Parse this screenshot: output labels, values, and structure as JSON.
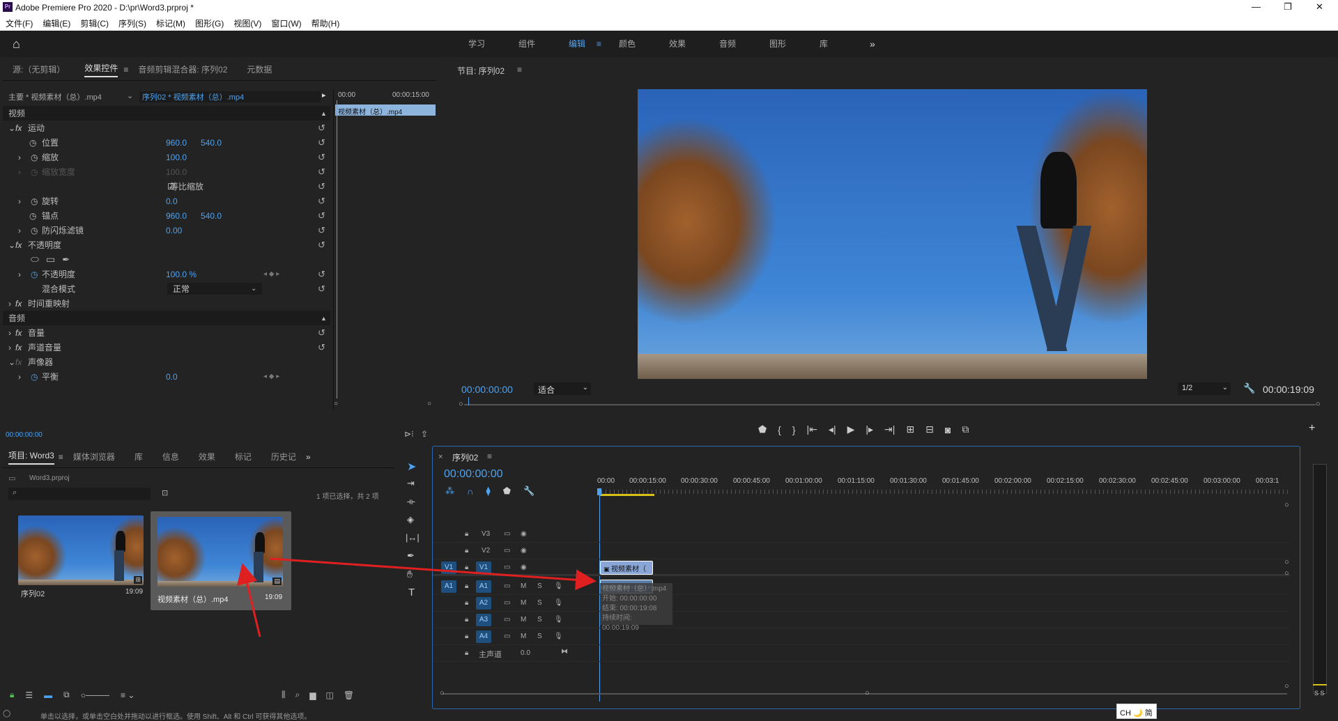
{
  "app": {
    "title": "Adobe Premiere Pro 2020 - D:\\pr\\Word3.prproj *",
    "window_controls": [
      "—",
      "❐",
      "✕"
    ]
  },
  "menu": [
    "文件(F)",
    "编辑(E)",
    "剪辑(C)",
    "序列(S)",
    "标记(M)",
    "图形(G)",
    "视图(V)",
    "窗口(W)",
    "帮助(H)"
  ],
  "workspaces": {
    "items": [
      "学习",
      "组件",
      "编辑",
      "颜色",
      "效果",
      "音频",
      "图形",
      "库"
    ],
    "active": "编辑",
    "more": "»"
  },
  "source_panel": {
    "tabs": [
      "源:（无剪辑）",
      "效果控件",
      "音频剪辑混合器: 序列02",
      "元数据"
    ],
    "active_tab": "效果控件",
    "master_label": "主要 * 视频素材（总）.mp4",
    "seq_label": "序列02 * 视频素材（总）.mp4",
    "mini_timeline": {
      "start": "00:00",
      "end": "00:00:15:00",
      "clip": "视频素材（总）.mp4"
    },
    "sections": {
      "video": "视频",
      "audio": "音频"
    },
    "props": [
      {
        "name": "运动",
        "fx": true
      },
      {
        "name": "位置",
        "v1": "960.0",
        "v2": "540.0"
      },
      {
        "name": "缩放",
        "v1": "100.0"
      },
      {
        "name": "缩放宽度",
        "v1": "100.0"
      },
      {
        "name": "等比缩放"
      },
      {
        "name": "旋转",
        "v1": "0.0"
      },
      {
        "name": "锚点",
        "v1": "960.0",
        "v2": "540.0"
      },
      {
        "name": "防闪烁滤镜",
        "v1": "0.00"
      },
      {
        "name": "不透明度",
        "fx": true
      },
      {
        "name": "不透明度",
        "v1": "100.0 %"
      },
      {
        "name": "混合模式",
        "v1": "正常"
      },
      {
        "name": "时间重映射",
        "fx": true
      },
      {
        "name": "音量",
        "fx": true
      },
      {
        "name": "声道音量",
        "fx": true
      },
      {
        "name": "声像器",
        "fx": true
      },
      {
        "name": "平衡",
        "v1": "0.0"
      }
    ],
    "timecode": "00:00:00:00"
  },
  "program_monitor": {
    "title": "节目: 序列02",
    "timecode": "00:00:00:00",
    "fit": "适合",
    "resolution": "1/2",
    "duration": "00:00:19:09"
  },
  "project_panel": {
    "tabs": [
      "项目: Word3",
      "媒体浏览器",
      "库",
      "信息",
      "效果",
      "标记",
      "历史记"
    ],
    "file": "Word3.prproj",
    "selection": "1 项已选择，共 2 项",
    "items": [
      {
        "name": "序列02",
        "duration": "19:09"
      },
      {
        "name": "视频素材（总）.mp4",
        "duration": "19:09"
      }
    ]
  },
  "timeline": {
    "title": "序列02",
    "timecode": "00:00:00:00",
    "ruler": [
      "00:00",
      "00:00:15:00",
      "00:00:30:00",
      "00:00:45:00",
      "00:01:00:00",
      "00:01:15:00",
      "00:01:30:00",
      "00:01:45:00",
      "00:02:00:00",
      "00:02:15:00",
      "00:02:30:00",
      "00:02:45:00",
      "00:03:00:00",
      "00:03:1"
    ],
    "tracks": [
      "V3",
      "V2",
      "V1",
      "A1",
      "A2",
      "A3",
      "A4"
    ],
    "master": "主声道",
    "master_val": "0.0",
    "clip_label": "视频素材（",
    "tooltip": [
      "视频素材（总）.mp4",
      "开始: 00:00:00:00",
      "结束: 00:00:19:08",
      "持续时间: 00:00:19:09"
    ]
  },
  "status_bar": "单击以选择，或单击空白处并拖动以进行框选。使用 Shift、Alt 和 Ctrl 可获得其他选项。",
  "ime": "CH 🌙 简",
  "colors": {
    "accent": "#4ea2ef",
    "arrow": "#e02020",
    "panel": "#232323"
  }
}
